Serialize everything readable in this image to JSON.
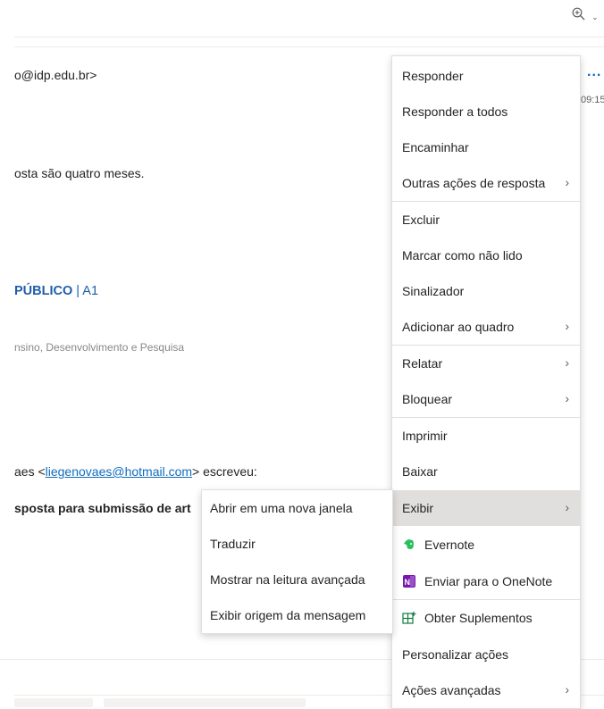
{
  "header": {
    "zoom_icon": "zoom-in-icon",
    "zoom_chevron": "⌄"
  },
  "message": {
    "sender_fragment": "o@idp.edu.br>",
    "body_line1": "osta são quatro meses.",
    "brand_name": "PÚBLICO",
    "brand_sep": " | ",
    "brand_rank": "A1",
    "institution": "nsino, Desenvolvimento e Pesquisa",
    "reply_prefix": "aes <",
    "reply_email": "liegenovaes@hotmail.com",
    "reply_suffix": "> escreveu:",
    "reply_subject": "sposta para submissão de art",
    "more_label": "...",
    "time": "09:15"
  },
  "context_menu": {
    "items": [
      {
        "label": "Responder"
      },
      {
        "label": "Responder a todos"
      },
      {
        "label": "Encaminhar"
      },
      {
        "label": "Outras ações de resposta",
        "arrow": "›"
      },
      {
        "label": "Excluir"
      },
      {
        "label": "Marcar como não lido"
      },
      {
        "label": "Sinalizador"
      },
      {
        "label": "Adicionar ao quadro",
        "arrow": "›"
      },
      {
        "label": "Relatar",
        "arrow": "›"
      },
      {
        "label": "Bloquear",
        "arrow": "›"
      },
      {
        "label": "Imprimir"
      },
      {
        "label": "Baixar"
      },
      {
        "label": "Exibir",
        "arrow": "›",
        "highlighted": true
      },
      {
        "label": "Evernote",
        "icon": "evernote-icon",
        "icon_color": "#2dbe60"
      },
      {
        "label": "Enviar para o OneNote",
        "icon": "onenote-icon",
        "icon_color": "#7719aa"
      },
      {
        "label": "Obter Suplementos",
        "icon": "add-ins-icon",
        "icon_color": "#107c41"
      },
      {
        "label": "Personalizar ações"
      },
      {
        "label": "Ações avançadas",
        "arrow": "›"
      }
    ]
  },
  "submenu": {
    "items": [
      {
        "label": "Abrir em uma nova janela"
      },
      {
        "label": "Traduzir"
      },
      {
        "label": "Mostrar na leitura avançada"
      },
      {
        "label": "Exibir origem da mensagem"
      }
    ]
  }
}
